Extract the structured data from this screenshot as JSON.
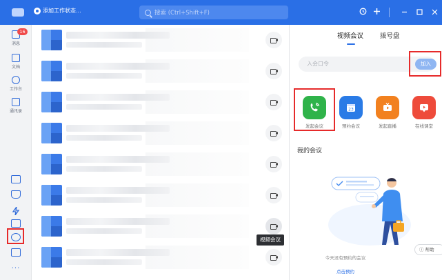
{
  "topbar": {
    "status_text": "添加工作状态...",
    "search_placeholder": "搜索 (Ctrl+Shift+F)",
    "icons": [
      "history-icon",
      "plus-icon",
      "minimize-icon",
      "maximize-icon",
      "close-icon"
    ]
  },
  "leftnav": {
    "badge": "16",
    "items": [
      {
        "label": "消息",
        "icon": "message-icon"
      },
      {
        "label": "文档",
        "icon": "document-icon"
      },
      {
        "label": "工作台",
        "icon": "workbench-icon"
      },
      {
        "label": "通讯录",
        "icon": "contacts-icon"
      }
    ],
    "annotation": "会议",
    "more": "···"
  },
  "list": {
    "tooltip": "视频会议",
    "row_count": 8
  },
  "panel": {
    "tabs": [
      "视频会议",
      "拨号盘"
    ],
    "join_placeholder": "入会口令",
    "join_button": "加入",
    "actions": [
      {
        "label": "发起会议",
        "color": "#2fb34a",
        "icon": "phone-icon"
      },
      {
        "label": "预约会议",
        "color": "#2a7be6",
        "icon": "calendar-icon"
      },
      {
        "label": "发起直播",
        "color": "#f2811f",
        "icon": "live-icon"
      },
      {
        "label": "在线课堂",
        "color": "#ee4b3b",
        "icon": "classroom-icon"
      }
    ],
    "my_meetings_title": "我的会议",
    "empty_text": "今天没有预约的会议",
    "schedule_link": "点击预约",
    "help_label": "帮助"
  }
}
